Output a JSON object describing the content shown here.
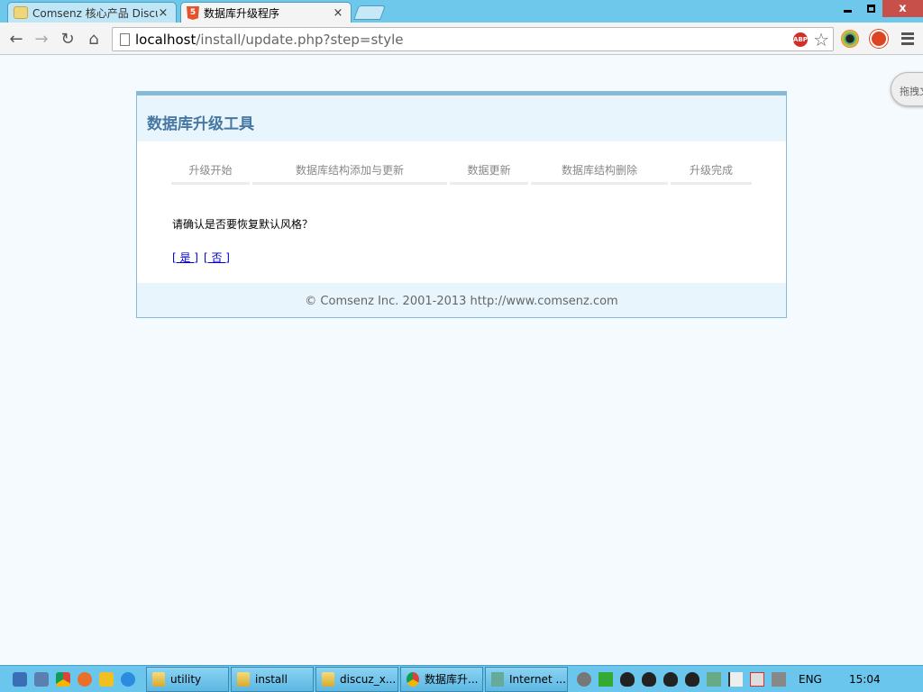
{
  "browser": {
    "tabs": [
      {
        "title": "Comsenz 核心产品 Discu",
        "close": "×"
      },
      {
        "title": "数据库升级程序",
        "close": "×"
      }
    ],
    "url": {
      "host": "localhost",
      "path": "/install/update.php?step=style"
    },
    "abp_label": "ABP",
    "window": {
      "close": "x"
    }
  },
  "page": {
    "cloud_label": "拖拽文",
    "title": "数据库升级工具",
    "steps": [
      "升级开始",
      "数据库结构添加与更新",
      "数据更新",
      "数据库结构删除",
      "升级完成"
    ],
    "question": "请确认是否要恢复默认风格？",
    "yes_link": "[ 是 ]",
    "no_link": "[ 否 ]",
    "footer": "© Comsenz Inc. 2001-2013 http://www.comsenz.com"
  },
  "taskbar": {
    "items": [
      "utility",
      "install",
      "discuz_x...",
      "数据库升...",
      "Internet ..."
    ],
    "language": "ENG",
    "time": "15:04"
  }
}
